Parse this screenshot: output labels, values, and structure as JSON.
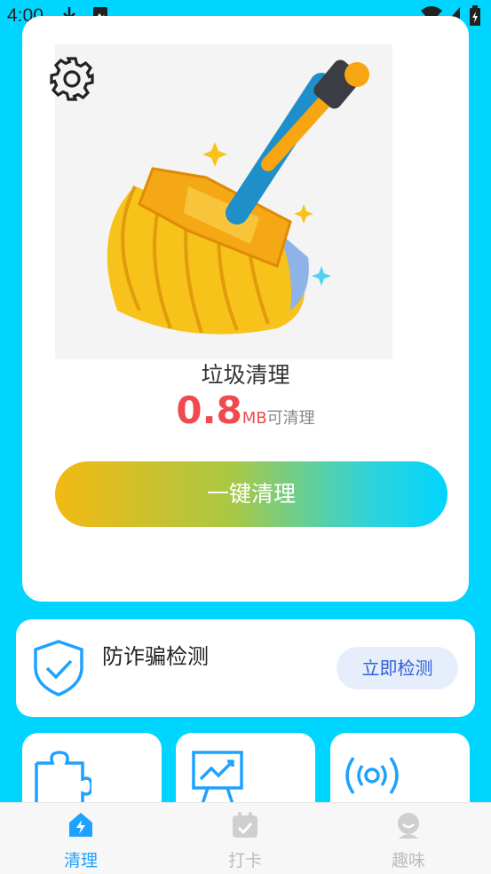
{
  "status_bar": {
    "time": "4:00"
  },
  "main_card": {
    "title": "垃圾清理",
    "size_value": "0.8",
    "size_unit": "MB",
    "size_suffix": "可清理",
    "clean_button": "一键清理"
  },
  "fraud_card": {
    "title": "防诈骗检测",
    "button": "立即检测"
  },
  "feature_tiles": [
    {
      "icon": "puzzle-icon"
    },
    {
      "icon": "presentation-chart-icon"
    },
    {
      "icon": "broadcast-signal-icon"
    }
  ],
  "bottom_nav": {
    "items": [
      {
        "label": "清理",
        "icon": "clean-home-icon",
        "active": true
      },
      {
        "label": "打卡",
        "icon": "calendar-check-icon",
        "active": false
      },
      {
        "label": "趣味",
        "icon": "fun-face-icon",
        "active": false
      }
    ],
    "active_color": "#1ea2ff",
    "inactive_color": "#bdbdbd"
  },
  "colors": {
    "background": "#00d5ff",
    "accent_red": "#f04a4e",
    "icon_blue": "#1ea2ff"
  }
}
